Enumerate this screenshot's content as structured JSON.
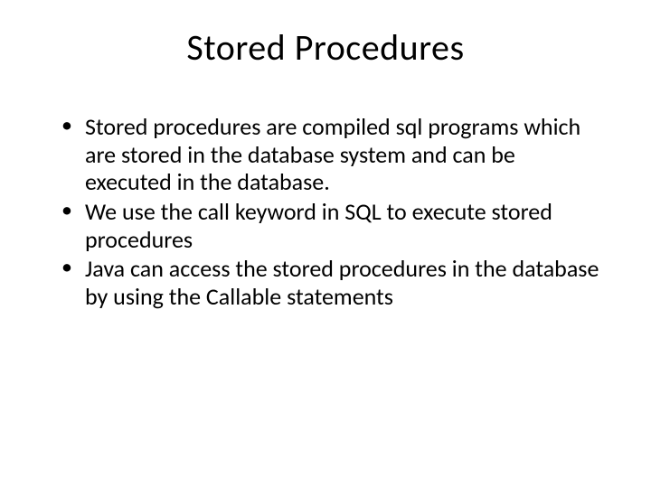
{
  "slide": {
    "title": "Stored Procedures",
    "bullets": [
      "Stored procedures are compiled sql programs which are stored in the database system and can be executed in the database.",
      "We use the call keyword in SQL to execute stored procedures",
      "Java can access the stored procedures in the database by using the Callable statements"
    ]
  }
}
